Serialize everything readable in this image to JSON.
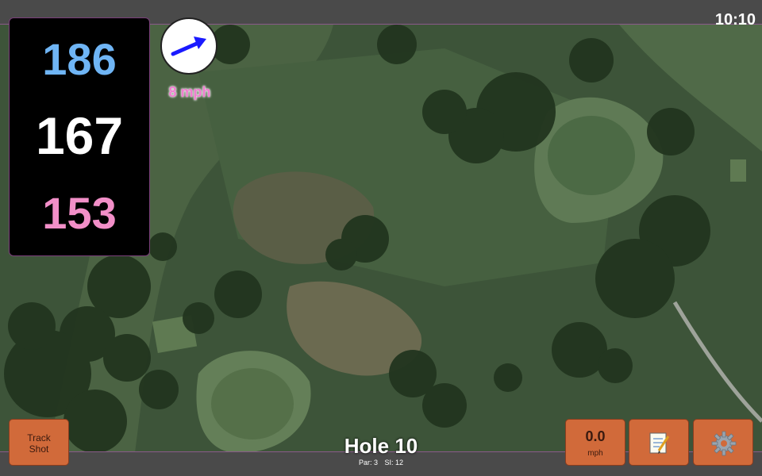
{
  "status": {
    "time": "10:10"
  },
  "distances": {
    "back": "186",
    "middle": "167",
    "front": "153"
  },
  "wind": {
    "speed_label": "8 mph",
    "arrow_color": "#1a1aff"
  },
  "hole": {
    "title": "Hole 10",
    "par_label": "Par: 3",
    "si_label": "SI: 12"
  },
  "buttons": {
    "track_shot_line1": "Track",
    "track_shot_line2": "Shot",
    "speed_value": "0.0",
    "speed_unit": "mph",
    "notes_icon": "notepad-icon",
    "settings_icon": "gear-icon"
  },
  "colors": {
    "back_distance": "#6fb5f5",
    "middle_distance": "#ffffff",
    "front_distance": "#f28fc8",
    "button_bg": "#d16a3a"
  }
}
